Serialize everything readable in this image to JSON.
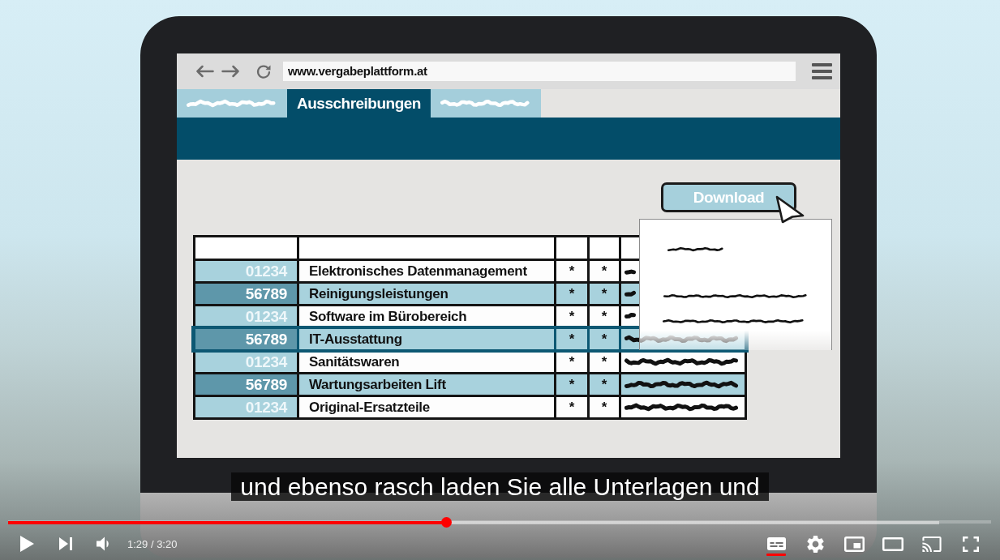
{
  "browser": {
    "url": "www.vergabeplattform.at",
    "tabs": [
      {
        "kind": "scribble",
        "selected": false
      },
      {
        "kind": "text",
        "label": "Ausschreibungen",
        "selected": true
      },
      {
        "kind": "scribble",
        "selected": false
      }
    ]
  },
  "download_button": {
    "label": "Download"
  },
  "table": {
    "rows": [
      {
        "number": "01234",
        "title": "Elektronisches Datenmanagement",
        "column_3": "*",
        "column_4": "*",
        "selected": false
      },
      {
        "number": "56789",
        "title": "Reinigungsleistungen",
        "column_3": "*",
        "column_4": "*",
        "selected": false
      },
      {
        "number": "01234",
        "title": "Software im Bürobereich",
        "column_3": "*",
        "column_4": "*",
        "selected": false
      },
      {
        "number": "56789",
        "title": "IT-Ausstattung",
        "column_3": "*",
        "column_4": "*",
        "selected": true
      },
      {
        "number": "01234",
        "title": "Sanitätswaren",
        "column_3": "*",
        "column_4": "*",
        "selected": false
      },
      {
        "number": "56789",
        "title": "Wartungsarbeiten Lift",
        "column_3": "*",
        "column_4": "*",
        "selected": false
      },
      {
        "number": "01234",
        "title": "Original-Ersatzteile",
        "column_3": "*",
        "column_4": "*",
        "selected": false
      }
    ]
  },
  "caption": "und ebenso rasch laden Sie alle Unterlagen und",
  "player": {
    "progress": {
      "level": 0.446
    },
    "buffer": {
      "level": 0.947
    },
    "time": "1:29 / 3:20",
    "subtitles": {
      "on": true
    }
  }
}
